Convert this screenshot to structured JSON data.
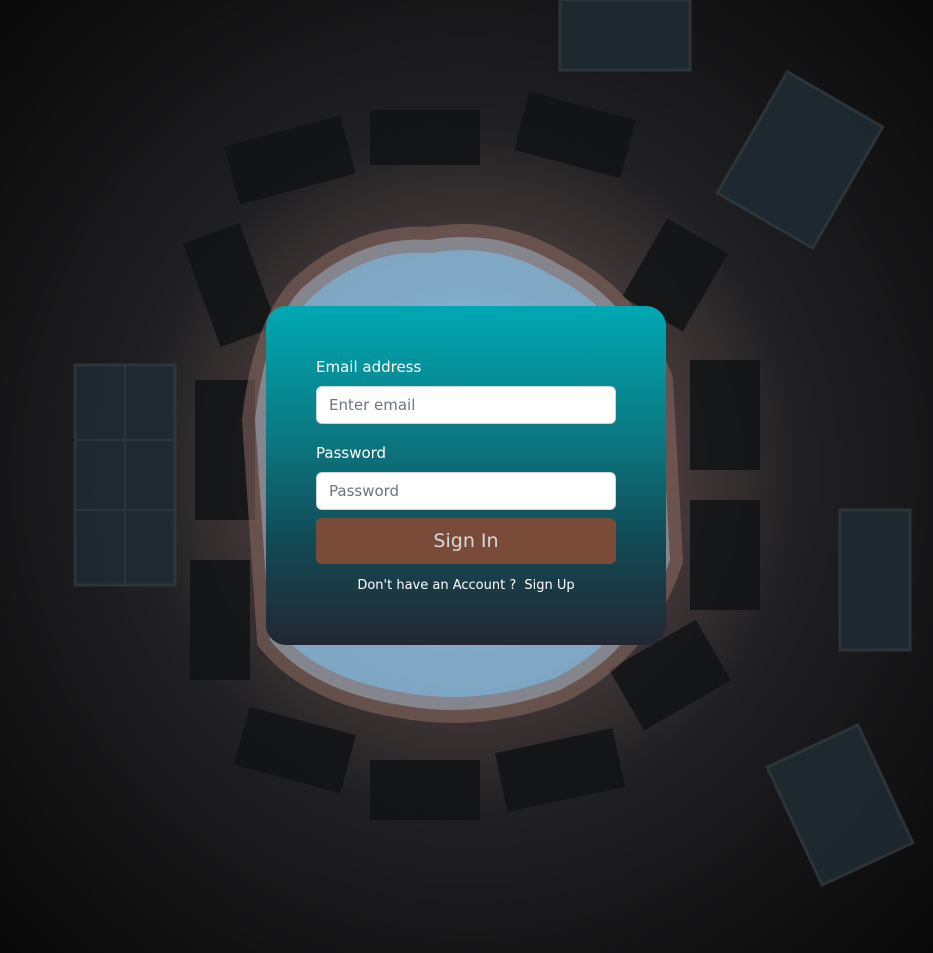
{
  "form": {
    "email_label": "Email address",
    "email_placeholder": "Enter email",
    "email_value": "",
    "password_label": "Password",
    "password_placeholder": "Password",
    "password_value": "",
    "submit_label": "Sign In",
    "footer_text": "Don't have an Account ?",
    "signup_link": "Sign Up"
  },
  "colors": {
    "card_top": "#00a8b3",
    "card_bottom": "#232632",
    "button_bg": "#7a4b38",
    "sky": "#86b6d6"
  },
  "background": {
    "image_alt": "upward view of building courtyard with sky"
  }
}
